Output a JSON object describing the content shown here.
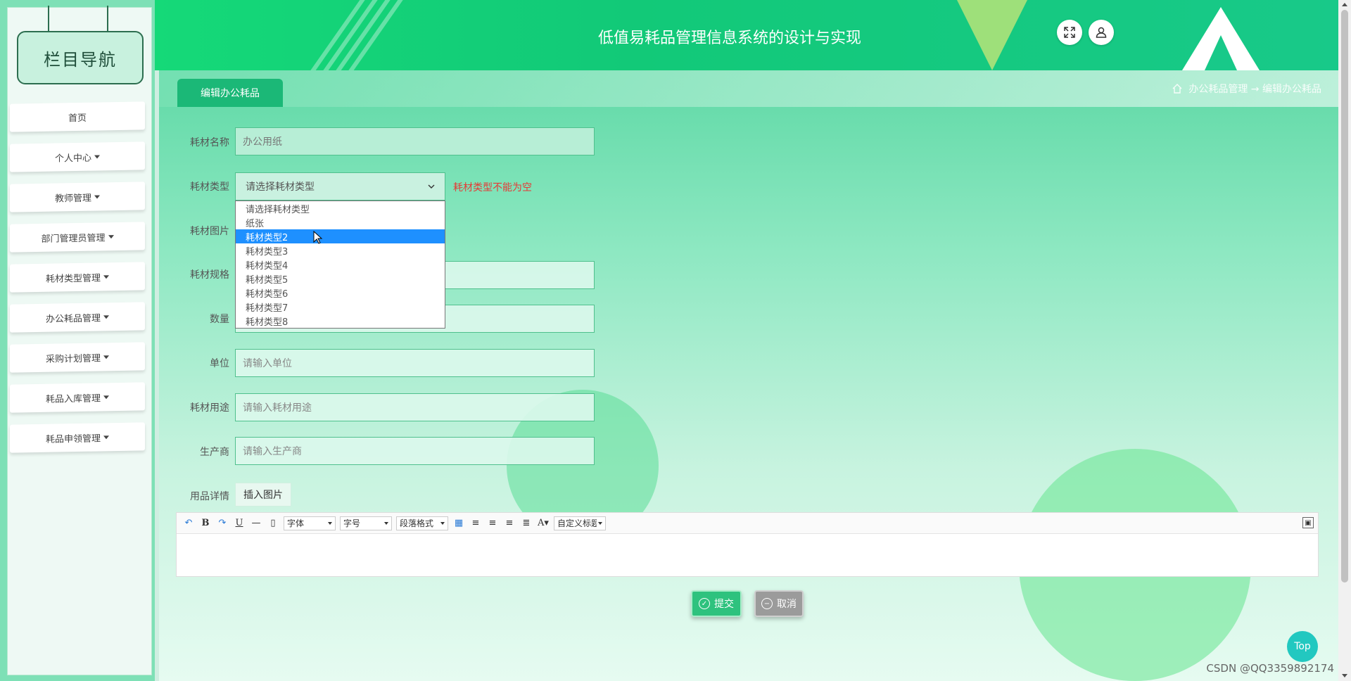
{
  "sidebar": {
    "title": "栏目导航",
    "items": [
      {
        "label": "首页",
        "has_caret": false
      },
      {
        "label": "个人中心",
        "has_caret": true
      },
      {
        "label": "教师管理",
        "has_caret": true
      },
      {
        "label": "部门管理员管理",
        "has_caret": true
      },
      {
        "label": "耗材类型管理",
        "has_caret": true
      },
      {
        "label": "办公耗品管理",
        "has_caret": true
      },
      {
        "label": "采购计划管理",
        "has_caret": true
      },
      {
        "label": "耗品入库管理",
        "has_caret": true
      },
      {
        "label": "耗品申领管理",
        "has_caret": true
      }
    ]
  },
  "header": {
    "title": "低值易耗品管理信息系统的设计与实现",
    "fullscreen_icon": "expand-icon",
    "user_icon": "user-icon"
  },
  "tab": {
    "label": "编辑办公耗品"
  },
  "breadcrumb": {
    "home_icon": "home-icon",
    "path": "办公耗品管理 → 编辑办公耗品"
  },
  "form": {
    "name": {
      "label": "耗材名称",
      "value": "办公用纸"
    },
    "type": {
      "label": "耗材类型",
      "selected": "请选择耗材类型",
      "error": "耗材类型不能为空",
      "options": [
        "请选择耗材类型",
        "纸张",
        "耗材类型2",
        "耗材类型3",
        "耗材类型4",
        "耗材类型5",
        "耗材类型6",
        "耗材类型7",
        "耗材类型8"
      ],
      "highlighted_index": 2
    },
    "image": {
      "label": "耗材图片"
    },
    "spec": {
      "label": "耗材规格"
    },
    "quantity": {
      "label": "数量"
    },
    "unit": {
      "label": "单位",
      "placeholder": "请输入单位"
    },
    "usage": {
      "label": "耗材用途",
      "placeholder": "请输入耗材用途"
    },
    "manufacturer": {
      "label": "生产商",
      "placeholder": "请输入生产商"
    },
    "details": {
      "label": "用品详情",
      "insert_image": "插入图片"
    }
  },
  "editor": {
    "font_combo": "字体",
    "size_combo": "字号",
    "paragraph_combo": "段落格式",
    "custom_combo": "自定义标题"
  },
  "buttons": {
    "submit": "提交",
    "cancel": "取消"
  },
  "top_button": "Top",
  "watermark": "CSDN @QQ3359892174",
  "colors": {
    "accent": "#1bb877",
    "error": "#e53935",
    "selected": "#1e90ff"
  }
}
